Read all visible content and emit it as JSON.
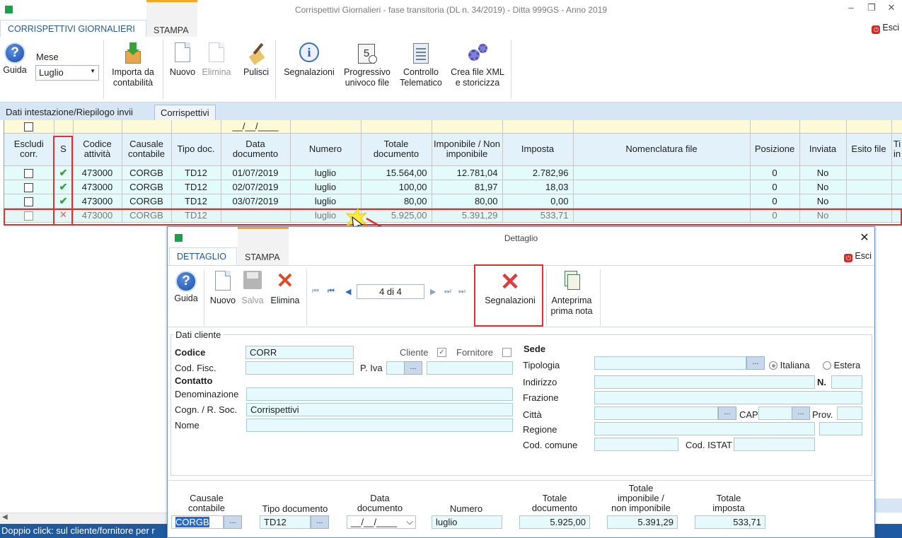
{
  "window": {
    "title": "Corrispettivi Giornalieri - fase transitoria (DL n. 34/2019) - Ditta 999GS - Anno 2019"
  },
  "tabs": {
    "main": "CORRISPETTIVI GIORNALIERI",
    "stampa": "STAMPA",
    "esci": "Esci"
  },
  "ribbon": {
    "guida": "Guida",
    "mese_label": "Mese",
    "mese_value": "Luglio",
    "importa_1": "Importa da",
    "importa_2": "contabilità",
    "nuovo": "Nuovo",
    "elimina": "Elimina",
    "pulisci": "Pulisci",
    "segnalazioni": "Segnalazioni",
    "progressivo_1": "Progressivo",
    "progressivo_2": "univoco file",
    "controllo_1": "Controllo",
    "controllo_2": "Telematico",
    "crea_1": "Crea file XML",
    "crea_2": "e storicizza"
  },
  "subtabs": {
    "intestazione": "Dati intestazione/Riepilogo invii",
    "corrispettivi": "Corrispettivi"
  },
  "grid": {
    "filter_date": "__/__/____",
    "headers": [
      "Escludi corr.",
      "S",
      "Codice attività",
      "Causale contabile",
      "Tipo doc.",
      "Data documento",
      "Numero",
      "Totale documento",
      "Imponibile / Non imponibile",
      "Imposta",
      "Nomenclatura file",
      "Posizione",
      "Inviata",
      "Esito file",
      "Ti in"
    ],
    "rows": [
      {
        "status": "ok",
        "codice": "473000",
        "causale": "CORGB",
        "tipo": "TD12",
        "data": "01/07/2019",
        "numero": "luglio",
        "totale": "15.564,00",
        "imponibile": "12.781,04",
        "imposta": "2.782,96",
        "nomenclatura": "",
        "posizione": "0",
        "inviata": "No"
      },
      {
        "status": "ok",
        "codice": "473000",
        "causale": "CORGB",
        "tipo": "TD12",
        "data": "02/07/2019",
        "numero": "luglio",
        "totale": "100,00",
        "imponibile": "81,97",
        "imposta": "18,03",
        "nomenclatura": "",
        "posizione": "0",
        "inviata": "No"
      },
      {
        "status": "ok",
        "codice": "473000",
        "causale": "CORGB",
        "tipo": "TD12",
        "data": "03/07/2019",
        "numero": "luglio",
        "totale": "80,00",
        "imponibile": "80,00",
        "imposta": "0,00",
        "nomenclatura": "",
        "posizione": "0",
        "inviata": "No"
      },
      {
        "status": "error",
        "codice": "473000",
        "causale": "CORGB",
        "tipo": "TD12",
        "data": "",
        "numero": "luglio",
        "totale": "5.925,00",
        "imponibile": "5.391,29",
        "imposta": "533,71",
        "nomenclatura": "",
        "posizione": "0",
        "inviata": "No"
      }
    ]
  },
  "status_bar": "Doppio click: sul cliente/fornitore per r",
  "dialog": {
    "title": "Dettaglio",
    "tab_dettaglio": "DETTAGLIO",
    "tab_stampa": "STAMPA",
    "esci": "Esci",
    "guida": "Guida",
    "nuovo": "Nuovo",
    "salva": "Salva",
    "elimina": "Elimina",
    "record_position": "4 di 4",
    "segnalazioni": "Segnalazioni",
    "anteprima_1": "Anteprima",
    "anteprima_2": "prima nota",
    "cliente": {
      "group": "Dati cliente",
      "codice_label": "Codice",
      "codice": "CORR",
      "cliente_label": "Cliente",
      "fornitore_label": "Fornitore",
      "codfisc_label": "Cod. Fisc.",
      "piva_label": "P. Iva",
      "contatto": "Contatto",
      "denominazione_label": "Denominazione",
      "cognome_label": "Cogn. / R. Soc.",
      "cognome": "Corrispettivi",
      "nome_label": "Nome"
    },
    "sede": {
      "title": "Sede",
      "tipologia_label": "Tipologia",
      "italiana": "Italiana",
      "estera": "Estera",
      "indirizzo_label": "Indirizzo",
      "n_label": "N.",
      "frazione_label": "Frazione",
      "citta_label": "Città",
      "cap_label": "CAP",
      "prov_label": "Prov.",
      "regione_label": "Regione",
      "comune_label": "Cod. comune",
      "istat_label": "Cod. ISTAT"
    },
    "footer": {
      "causale_1": "Causale",
      "causale_2": "contabile",
      "causale": "CORGB",
      "tipo_label": "Tipo documento",
      "tipo": "TD12",
      "data_1": "Data",
      "data_2": "documento",
      "data": "__/__/____",
      "numero_label": "Numero",
      "numero": "luglio",
      "totale_1": "Totale",
      "totale_2": "documento",
      "totale": "5.925,00",
      "imponibile_1": "Totale",
      "imponibile_2": "imponibile /",
      "imponibile_3": "non imponibile",
      "imponibile": "5.391,29",
      "imposta_1": "Totale",
      "imposta_2": "imposta",
      "imposta": "533,71"
    }
  }
}
